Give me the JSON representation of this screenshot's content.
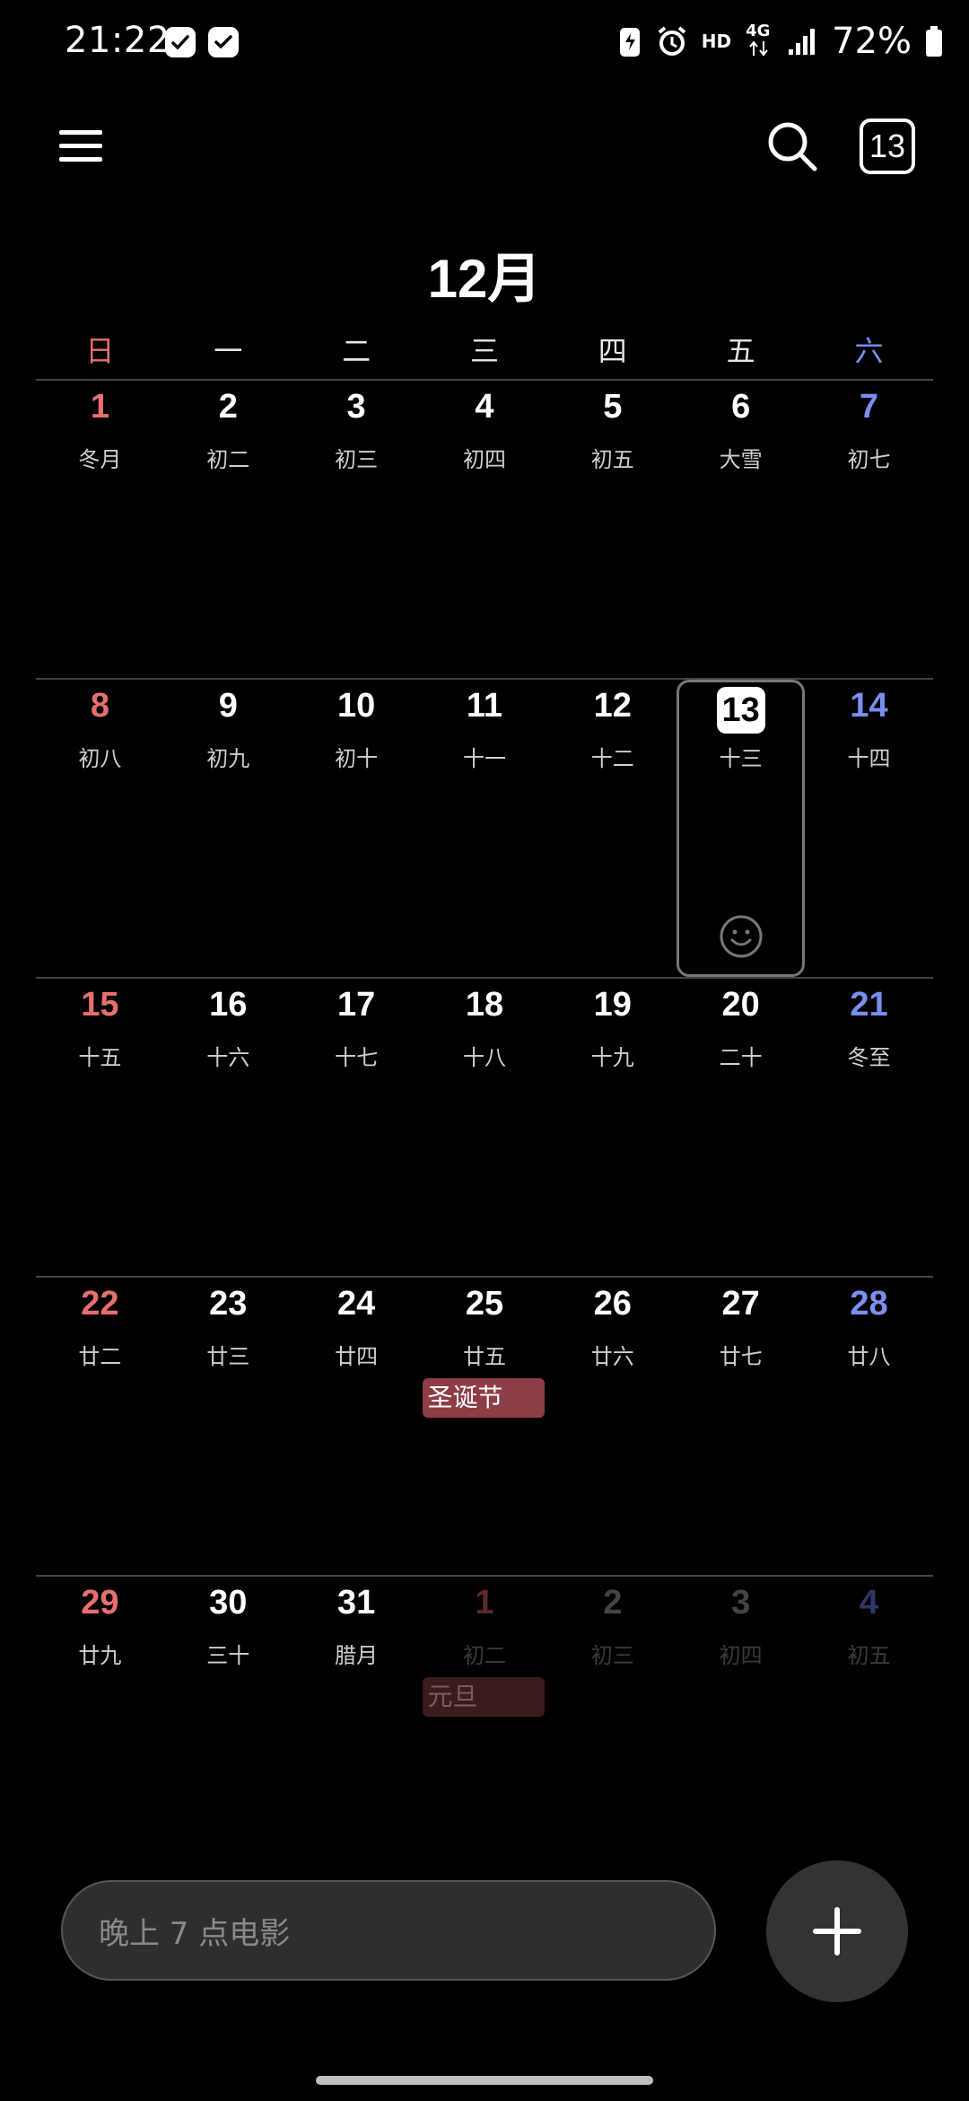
{
  "status_bar": {
    "time": "21:22",
    "network": "HD",
    "data_type": "4G",
    "battery": "72%"
  },
  "toolbar": {
    "menu_icon": "hamburger-menu-icon",
    "search_icon": "search-icon",
    "today_label": "13"
  },
  "month_title": "12月",
  "weekdays": [
    "日",
    "一",
    "二",
    "三",
    "四",
    "五",
    "六"
  ],
  "weeks": [
    [
      {
        "day": "1",
        "lunar": "冬月"
      },
      {
        "day": "2",
        "lunar": "初二"
      },
      {
        "day": "3",
        "lunar": "初三"
      },
      {
        "day": "4",
        "lunar": "初四"
      },
      {
        "day": "5",
        "lunar": "初五"
      },
      {
        "day": "6",
        "lunar": "大雪"
      },
      {
        "day": "7",
        "lunar": "初七"
      }
    ],
    [
      {
        "day": "8",
        "lunar": "初八"
      },
      {
        "day": "9",
        "lunar": "初九"
      },
      {
        "day": "10",
        "lunar": "初十"
      },
      {
        "day": "11",
        "lunar": "十一"
      },
      {
        "day": "12",
        "lunar": "十二"
      },
      {
        "day": "13",
        "lunar": "十三",
        "today": true
      },
      {
        "day": "14",
        "lunar": "十四"
      }
    ],
    [
      {
        "day": "15",
        "lunar": "十五"
      },
      {
        "day": "16",
        "lunar": "十六"
      },
      {
        "day": "17",
        "lunar": "十七"
      },
      {
        "day": "18",
        "lunar": "十八"
      },
      {
        "day": "19",
        "lunar": "十九"
      },
      {
        "day": "20",
        "lunar": "二十"
      },
      {
        "day": "21",
        "lunar": "冬至"
      }
    ],
    [
      {
        "day": "22",
        "lunar": "廿二"
      },
      {
        "day": "23",
        "lunar": "廿三"
      },
      {
        "day": "24",
        "lunar": "廿四"
      },
      {
        "day": "25",
        "lunar": "廿五",
        "event": "圣诞节"
      },
      {
        "day": "26",
        "lunar": "廿六"
      },
      {
        "day": "27",
        "lunar": "廿七"
      },
      {
        "day": "28",
        "lunar": "廿八"
      }
    ],
    [
      {
        "day": "29",
        "lunar": "廿九"
      },
      {
        "day": "30",
        "lunar": "三十"
      },
      {
        "day": "31",
        "lunar": "腊月"
      },
      {
        "day": "1",
        "lunar": "初二",
        "other_month": true,
        "event": "元旦"
      },
      {
        "day": "2",
        "lunar": "初三",
        "other_month": true
      },
      {
        "day": "3",
        "lunar": "初四",
        "other_month": true
      },
      {
        "day": "4",
        "lunar": "初五",
        "other_month": true
      }
    ]
  ],
  "quick_add": {
    "placeholder": "晚上 7 点电影"
  },
  "fab": {
    "icon": "plus-icon"
  },
  "colors": {
    "sunday": "#e76f6f",
    "saturday": "#7b8ff0",
    "holiday_chip": "#8c3d45",
    "background": "#000000"
  }
}
